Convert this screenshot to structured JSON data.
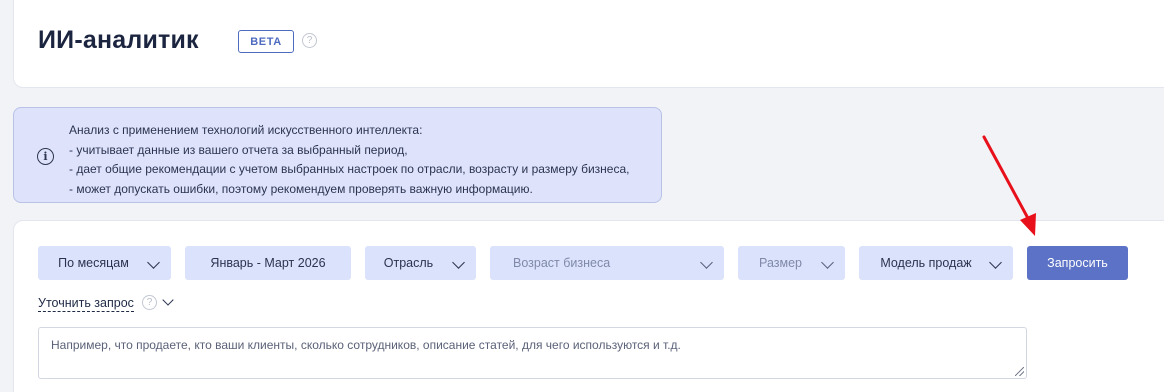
{
  "header": {
    "title": "ИИ-аналитик",
    "badge": "BETA",
    "help_symbol": "?"
  },
  "info": {
    "icon": "info-icon",
    "icon_symbol": "i",
    "lines": [
      "Анализ с применением технологий искусственного интеллекта:",
      "- учитывает данные из вашего отчета за выбранный период,",
      "- дает общие рекомендации с учетом выбранных настроек по отрасли, возрасту и размеру бизнеса,",
      "- может допускать ошибки, поэтому рекомендуем проверять важную информацию."
    ]
  },
  "filters": {
    "period_type": "По месяцам",
    "date_range": "Январь - Март 2026",
    "industry": "Отрасль",
    "business_age": "Возраст бизнеса",
    "size": "Размер",
    "sales_model": "Модель продаж"
  },
  "actions": {
    "submit": "Запросить"
  },
  "refine": {
    "label": "Уточнить запрос",
    "help_symbol": "?"
  },
  "query": {
    "placeholder": "Например, что продаете, кто ваши клиенты, сколько сотрудников, описание статей, для чего используются и т.д."
  },
  "annotation": {
    "arrow_color": "#e8101a"
  }
}
